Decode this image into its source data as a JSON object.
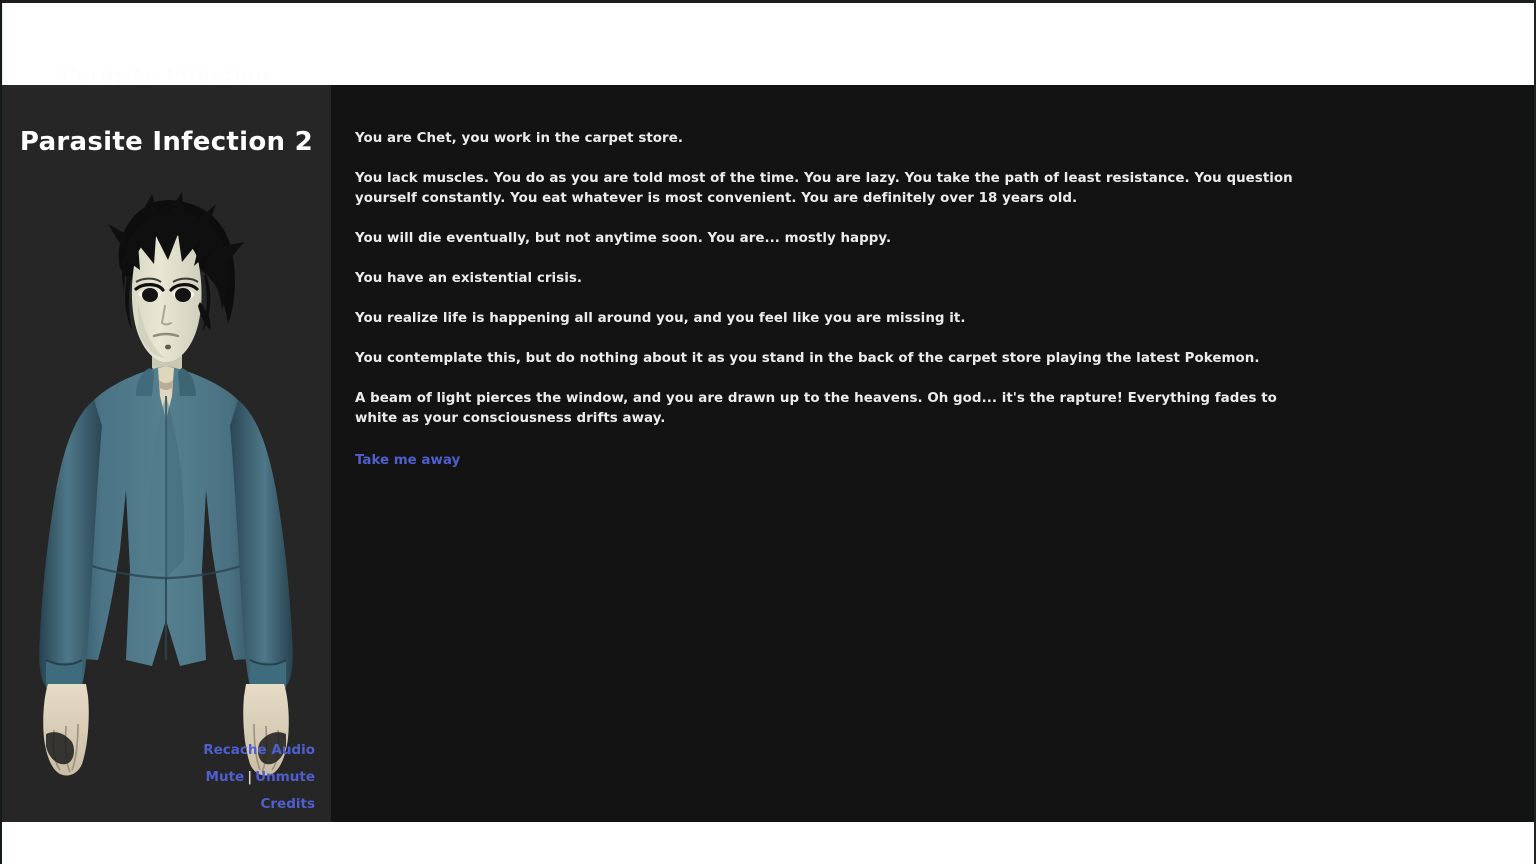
{
  "browser": {
    "ghost_header_text": "Parasite Infection"
  },
  "sidebar": {
    "game_title": "Parasite Infection 2",
    "character_art_name": "chet-character-portrait",
    "links": {
      "recache_audio": "Recache Audio",
      "mute": "Mute",
      "separator": "|",
      "unmute": "Unmute",
      "credits": "Credits"
    }
  },
  "story": {
    "paragraphs": [
      "You are Chet, you work in the carpet store.",
      "You lack muscles. You do as you are told most of the time. You are lazy. You take the path of least resistance. You question yourself constantly. You eat whatever is most convenient. You are definitely over 18 years old.",
      "You will die eventually, but not anytime soon. You are... mostly happy.",
      "You have an existential crisis.",
      "You realize life is happening all around you, and you feel like you are missing it.",
      "You contemplate this, but do nothing about it as you stand in the back of the carpet store playing the latest Pokemon.",
      "A beam of light pierces the window, and you are drawn up to the heavens. Oh god... it's the rapture! Everything fades to white as your consciousness drifts away."
    ],
    "choice_label": "Take me away"
  },
  "colors": {
    "link_blue": "#4f5fcf",
    "panel_bg": "#131313",
    "sidebar_bg": "#262626",
    "text": "#ececec",
    "jacket_teal": "#4a7283",
    "skin": "#e9e3cf",
    "hair": "#111111"
  }
}
